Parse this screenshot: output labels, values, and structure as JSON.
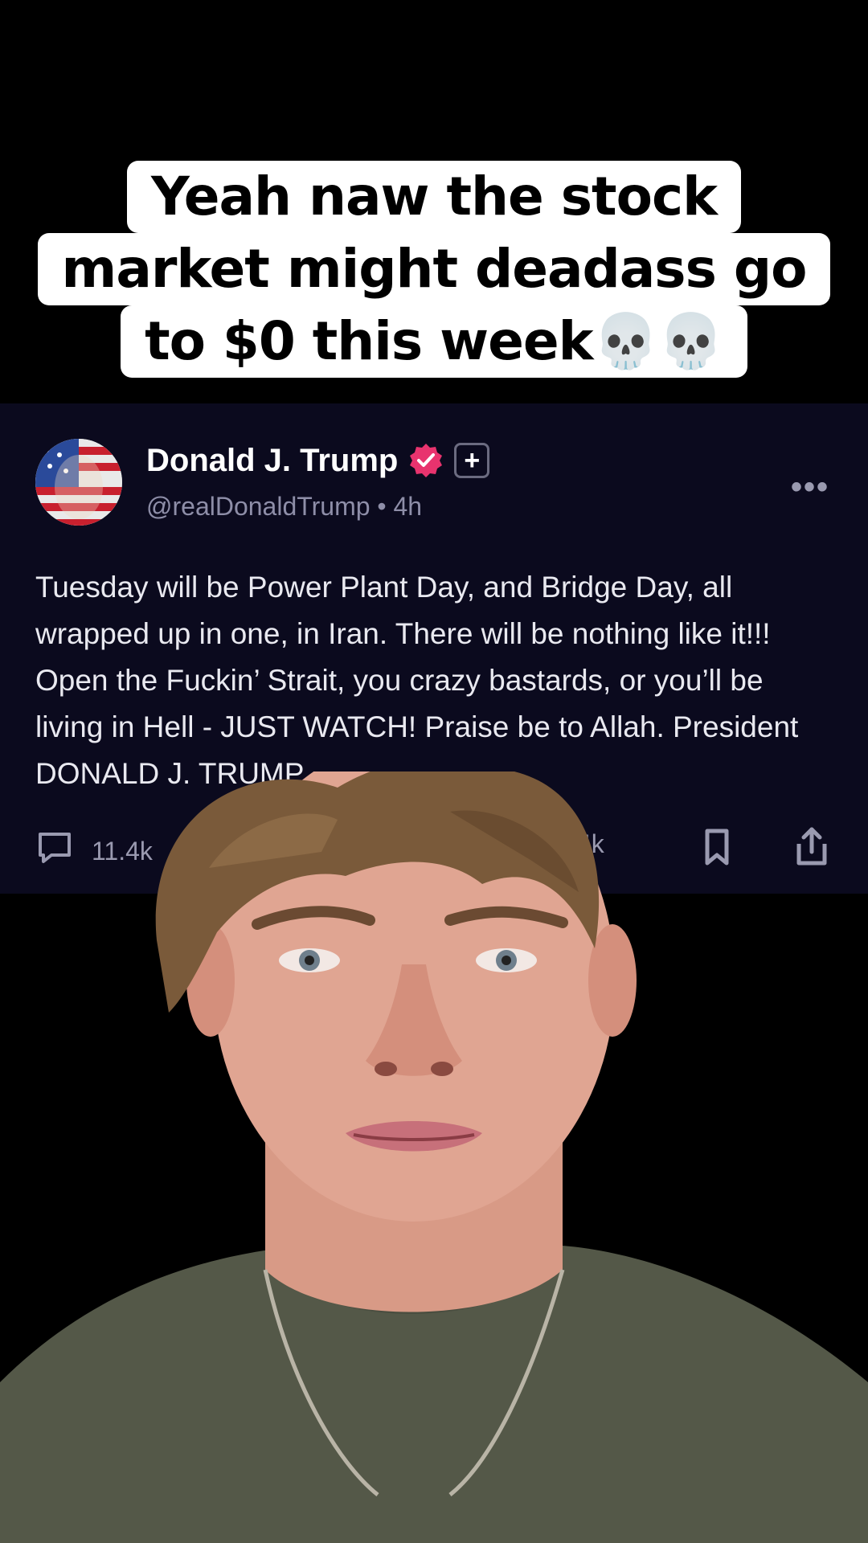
{
  "caption": {
    "line1": "Yeah naw the stock",
    "line2": "market might deadass go",
    "line3": "to $0 this week💀💀"
  },
  "post": {
    "author_name": "Donald J. Trump",
    "handle": "@realDonaldTrump",
    "separator": "•",
    "time": "4h",
    "more_label": "•••",
    "body": "Tuesday will be Power Plant Day, and Bridge Day, all wrapped up in one, in Iran. There will be nothing like it!!! Open the Fuckin’ Strait, you crazy bastards, or you’ll be living in Hell - JUST WATCH! Praise be to Allah. President DONALD J. TRUMP",
    "plus_badge": "+",
    "actions": {
      "replies": "11.4k",
      "likes_partial": "4k"
    }
  },
  "colors": {
    "post_bg": "#0b0a1e",
    "verified": "#e8336e",
    "caption_bg": "#ffffff"
  },
  "icons": [
    "reply-icon",
    "bookmark-icon",
    "share-icon",
    "verified-badge-icon",
    "more-icon"
  ]
}
